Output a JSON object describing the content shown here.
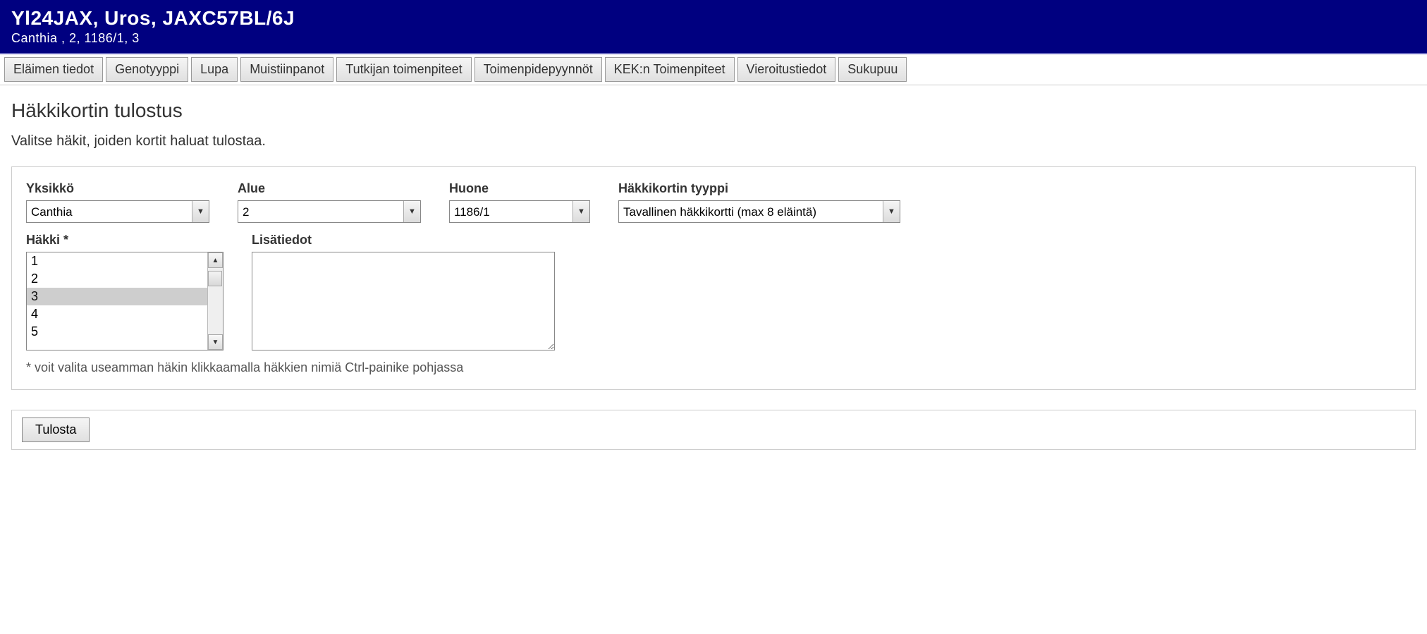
{
  "header": {
    "title": "Yl24JAX, Uros, JAXC57BL/6J",
    "subtitle": "Canthia , 2, 1186/1, 3"
  },
  "tabs": [
    "Eläimen tiedot",
    "Genotyyppi",
    "Lupa",
    "Muistiinpanot",
    "Tutkijan toimenpiteet",
    "Toimenpidepyynnöt",
    "KEK:n Toimenpiteet",
    "Vieroitustiedot",
    "Sukupuu"
  ],
  "page": {
    "title": "Häkkikortin tulostus",
    "instructions": "Valitse häkit, joiden kortit haluat tulostaa."
  },
  "form": {
    "yksikko": {
      "label": "Yksikkö",
      "value": "Canthia"
    },
    "alue": {
      "label": "Alue",
      "value": "2"
    },
    "huone": {
      "label": "Huone",
      "value": "1186/1"
    },
    "tyyppi": {
      "label": "Häkkikortin tyyppi",
      "value": "Tavallinen häkkikortti (max 8 eläintä)"
    },
    "hakki": {
      "label": "Häkki *",
      "options": [
        "1",
        "2",
        "3",
        "4",
        "5"
      ],
      "selected": "3"
    },
    "lisatiedot": {
      "label": "Lisätiedot",
      "value": ""
    },
    "hint": "* voit valita useamman häkin klikkaamalla häkkien nimiä Ctrl-painike pohjassa"
  },
  "actions": {
    "print": "Tulosta"
  }
}
